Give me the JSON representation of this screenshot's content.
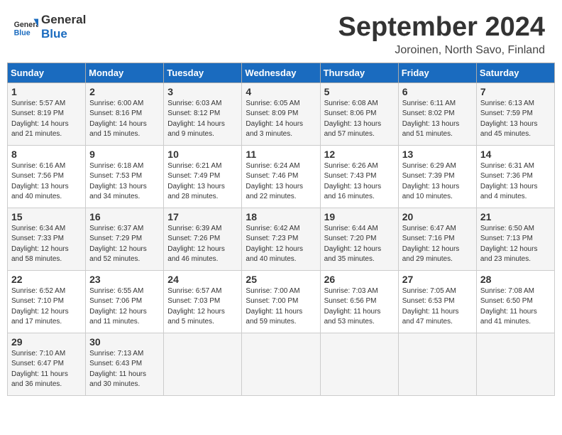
{
  "header": {
    "logo_general": "General",
    "logo_blue": "Blue",
    "month": "September 2024",
    "location": "Joroinen, North Savo, Finland"
  },
  "days_of_week": [
    "Sunday",
    "Monday",
    "Tuesday",
    "Wednesday",
    "Thursday",
    "Friday",
    "Saturday"
  ],
  "weeks": [
    [
      {
        "num": "1",
        "sunrise": "Sunrise: 5:57 AM",
        "sunset": "Sunset: 8:19 PM",
        "daylight": "Daylight: 14 hours and 21 minutes."
      },
      {
        "num": "2",
        "sunrise": "Sunrise: 6:00 AM",
        "sunset": "Sunset: 8:16 PM",
        "daylight": "Daylight: 14 hours and 15 minutes."
      },
      {
        "num": "3",
        "sunrise": "Sunrise: 6:03 AM",
        "sunset": "Sunset: 8:12 PM",
        "daylight": "Daylight: 14 hours and 9 minutes."
      },
      {
        "num": "4",
        "sunrise": "Sunrise: 6:05 AM",
        "sunset": "Sunset: 8:09 PM",
        "daylight": "Daylight: 14 hours and 3 minutes."
      },
      {
        "num": "5",
        "sunrise": "Sunrise: 6:08 AM",
        "sunset": "Sunset: 8:06 PM",
        "daylight": "Daylight: 13 hours and 57 minutes."
      },
      {
        "num": "6",
        "sunrise": "Sunrise: 6:11 AM",
        "sunset": "Sunset: 8:02 PM",
        "daylight": "Daylight: 13 hours and 51 minutes."
      },
      {
        "num": "7",
        "sunrise": "Sunrise: 6:13 AM",
        "sunset": "Sunset: 7:59 PM",
        "daylight": "Daylight: 13 hours and 45 minutes."
      }
    ],
    [
      {
        "num": "8",
        "sunrise": "Sunrise: 6:16 AM",
        "sunset": "Sunset: 7:56 PM",
        "daylight": "Daylight: 13 hours and 40 minutes."
      },
      {
        "num": "9",
        "sunrise": "Sunrise: 6:18 AM",
        "sunset": "Sunset: 7:53 PM",
        "daylight": "Daylight: 13 hours and 34 minutes."
      },
      {
        "num": "10",
        "sunrise": "Sunrise: 6:21 AM",
        "sunset": "Sunset: 7:49 PM",
        "daylight": "Daylight: 13 hours and 28 minutes."
      },
      {
        "num": "11",
        "sunrise": "Sunrise: 6:24 AM",
        "sunset": "Sunset: 7:46 PM",
        "daylight": "Daylight: 13 hours and 22 minutes."
      },
      {
        "num": "12",
        "sunrise": "Sunrise: 6:26 AM",
        "sunset": "Sunset: 7:43 PM",
        "daylight": "Daylight: 13 hours and 16 minutes."
      },
      {
        "num": "13",
        "sunrise": "Sunrise: 6:29 AM",
        "sunset": "Sunset: 7:39 PM",
        "daylight": "Daylight: 13 hours and 10 minutes."
      },
      {
        "num": "14",
        "sunrise": "Sunrise: 6:31 AM",
        "sunset": "Sunset: 7:36 PM",
        "daylight": "Daylight: 13 hours and 4 minutes."
      }
    ],
    [
      {
        "num": "15",
        "sunrise": "Sunrise: 6:34 AM",
        "sunset": "Sunset: 7:33 PM",
        "daylight": "Daylight: 12 hours and 58 minutes."
      },
      {
        "num": "16",
        "sunrise": "Sunrise: 6:37 AM",
        "sunset": "Sunset: 7:29 PM",
        "daylight": "Daylight: 12 hours and 52 minutes."
      },
      {
        "num": "17",
        "sunrise": "Sunrise: 6:39 AM",
        "sunset": "Sunset: 7:26 PM",
        "daylight": "Daylight: 12 hours and 46 minutes."
      },
      {
        "num": "18",
        "sunrise": "Sunrise: 6:42 AM",
        "sunset": "Sunset: 7:23 PM",
        "daylight": "Daylight: 12 hours and 40 minutes."
      },
      {
        "num": "19",
        "sunrise": "Sunrise: 6:44 AM",
        "sunset": "Sunset: 7:20 PM",
        "daylight": "Daylight: 12 hours and 35 minutes."
      },
      {
        "num": "20",
        "sunrise": "Sunrise: 6:47 AM",
        "sunset": "Sunset: 7:16 PM",
        "daylight": "Daylight: 12 hours and 29 minutes."
      },
      {
        "num": "21",
        "sunrise": "Sunrise: 6:50 AM",
        "sunset": "Sunset: 7:13 PM",
        "daylight": "Daylight: 12 hours and 23 minutes."
      }
    ],
    [
      {
        "num": "22",
        "sunrise": "Sunrise: 6:52 AM",
        "sunset": "Sunset: 7:10 PM",
        "daylight": "Daylight: 12 hours and 17 minutes."
      },
      {
        "num": "23",
        "sunrise": "Sunrise: 6:55 AM",
        "sunset": "Sunset: 7:06 PM",
        "daylight": "Daylight: 12 hours and 11 minutes."
      },
      {
        "num": "24",
        "sunrise": "Sunrise: 6:57 AM",
        "sunset": "Sunset: 7:03 PM",
        "daylight": "Daylight: 12 hours and 5 minutes."
      },
      {
        "num": "25",
        "sunrise": "Sunrise: 7:00 AM",
        "sunset": "Sunset: 7:00 PM",
        "daylight": "Daylight: 11 hours and 59 minutes."
      },
      {
        "num": "26",
        "sunrise": "Sunrise: 7:03 AM",
        "sunset": "Sunset: 6:56 PM",
        "daylight": "Daylight: 11 hours and 53 minutes."
      },
      {
        "num": "27",
        "sunrise": "Sunrise: 7:05 AM",
        "sunset": "Sunset: 6:53 PM",
        "daylight": "Daylight: 11 hours and 47 minutes."
      },
      {
        "num": "28",
        "sunrise": "Sunrise: 7:08 AM",
        "sunset": "Sunset: 6:50 PM",
        "daylight": "Daylight: 11 hours and 41 minutes."
      }
    ],
    [
      {
        "num": "29",
        "sunrise": "Sunrise: 7:10 AM",
        "sunset": "Sunset: 6:47 PM",
        "daylight": "Daylight: 11 hours and 36 minutes."
      },
      {
        "num": "30",
        "sunrise": "Sunrise: 7:13 AM",
        "sunset": "Sunset: 6:43 PM",
        "daylight": "Daylight: 11 hours and 30 minutes."
      },
      null,
      null,
      null,
      null,
      null
    ]
  ]
}
